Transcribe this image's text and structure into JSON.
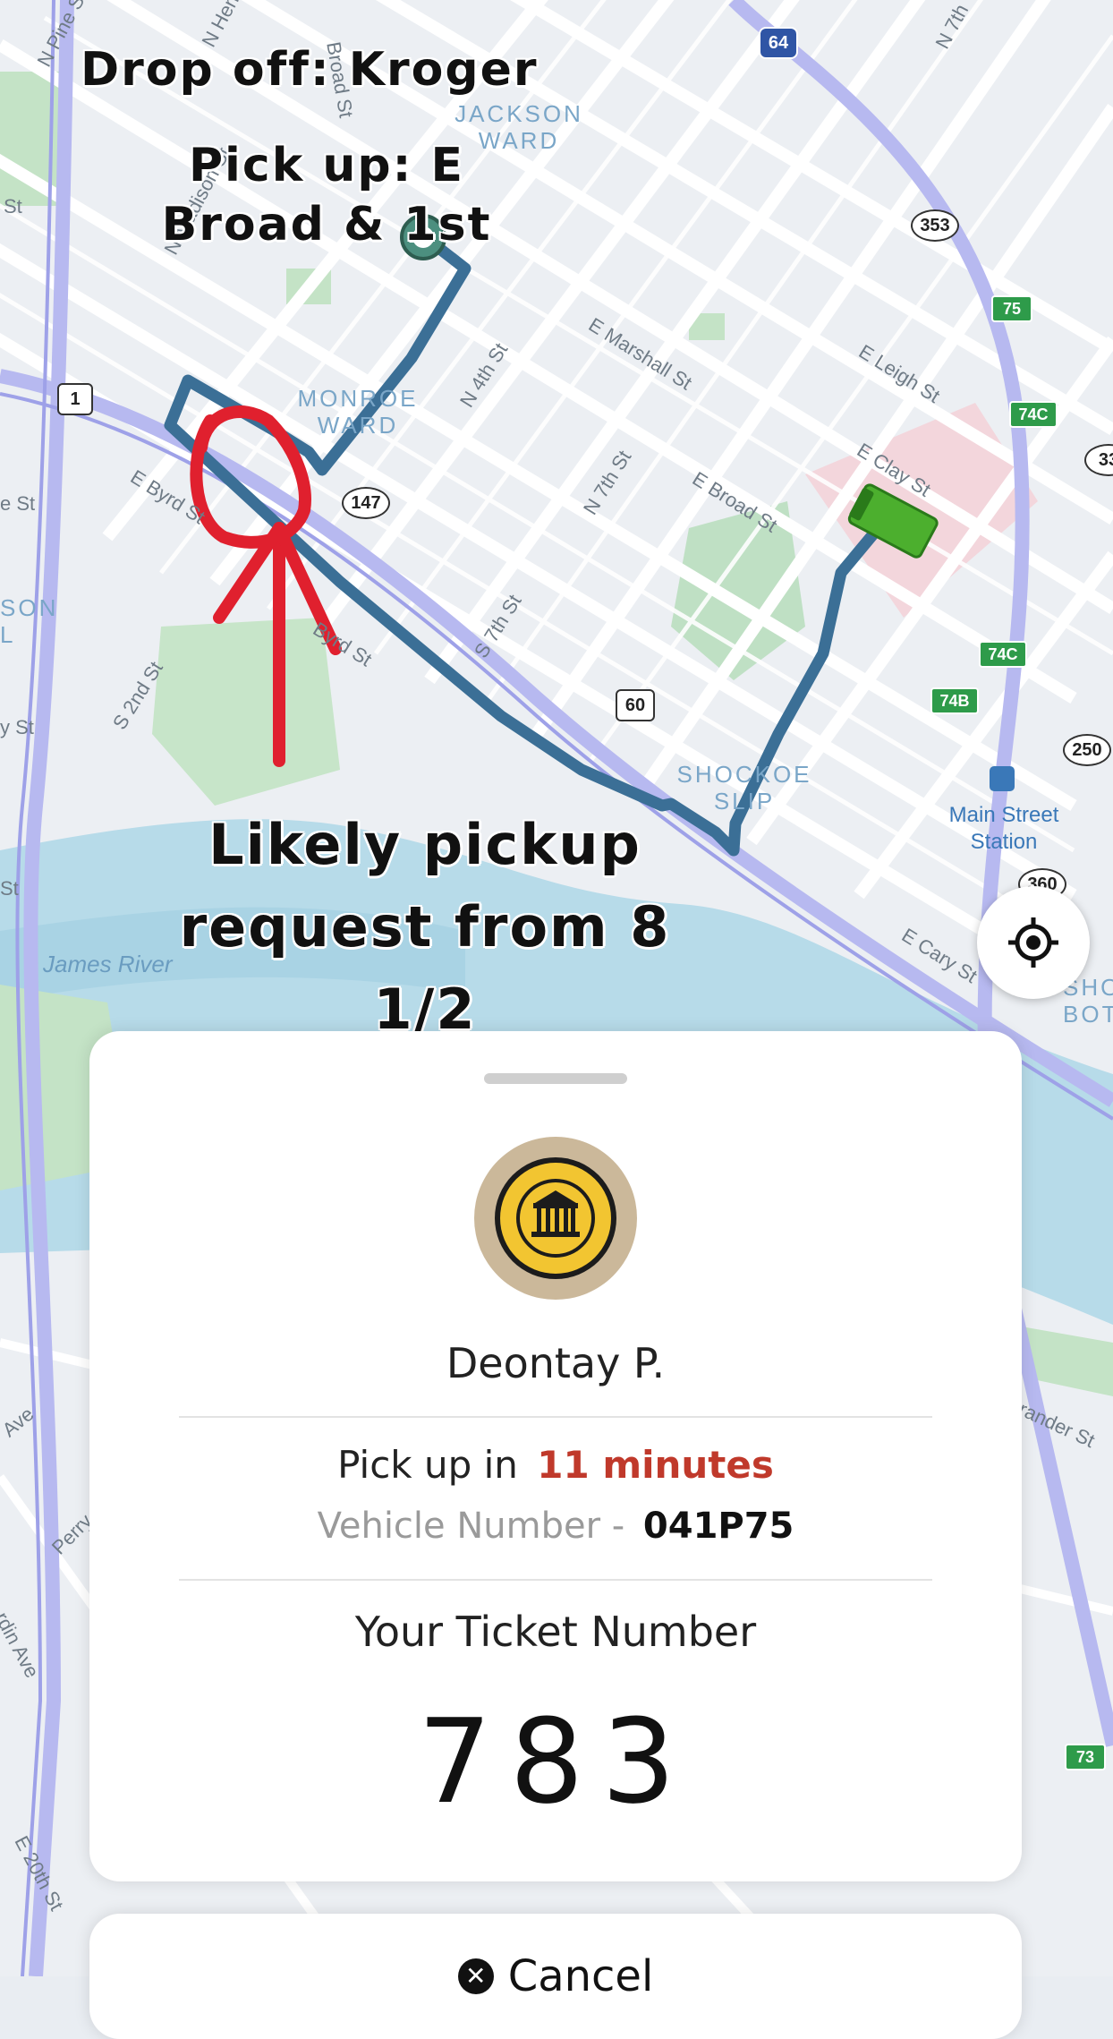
{
  "map": {
    "streets": [
      "N Pine St",
      "N Henry St",
      "N Madison St",
      "Broad St",
      "E Marshall St",
      "E Leigh St",
      "E Clay St",
      "E Broad St",
      "N 4th St",
      "N 7th St",
      "S 7th St",
      "E Byrd St",
      "Byrd St",
      "S 2nd St",
      "E Cary St",
      "N 7th",
      "E 20th St",
      "Ave",
      "Perry St",
      "rdin Ave",
      "rander St"
    ],
    "districts": [
      "JACKSON WARD",
      "MONROE WARD",
      "SHOCKOE SLIP",
      "SON L",
      "SHO BOT"
    ],
    "water": "James River",
    "route_shields": [
      "64",
      "353",
      "1",
      "147",
      "60",
      "250",
      "360",
      "33"
    ],
    "green_shields": [
      "75",
      "74C",
      "74C",
      "74B",
      "73"
    ],
    "station": "Main Street Station",
    "partial_labels": [
      "St",
      "e St",
      "y St",
      "St"
    ]
  },
  "annotations": {
    "dropoff": "Drop off: Kroger",
    "pickup": "Pick up: E Broad & 1st",
    "likely": "Likely pickup request from 8 1/2"
  },
  "controls": {
    "locate_icon": "crosshair-location-icon"
  },
  "card": {
    "avatar_icon": "university-seal-avatar",
    "driver_name": "Deontay P.",
    "pickup_prefix": "Pick up in",
    "pickup_time": "11 minutes",
    "vehicle_prefix": "Vehicle Number -",
    "vehicle_number": "041P75",
    "ticket_label": "Your Ticket Number",
    "ticket_number": "783"
  },
  "cancel": {
    "label": "Cancel",
    "icon": "close-circle-icon"
  },
  "colors": {
    "route": "#3b6f96",
    "annotation_ink": "#e0202e",
    "shuttle": "#4caf2e",
    "pickup_time": "#c0392b"
  }
}
